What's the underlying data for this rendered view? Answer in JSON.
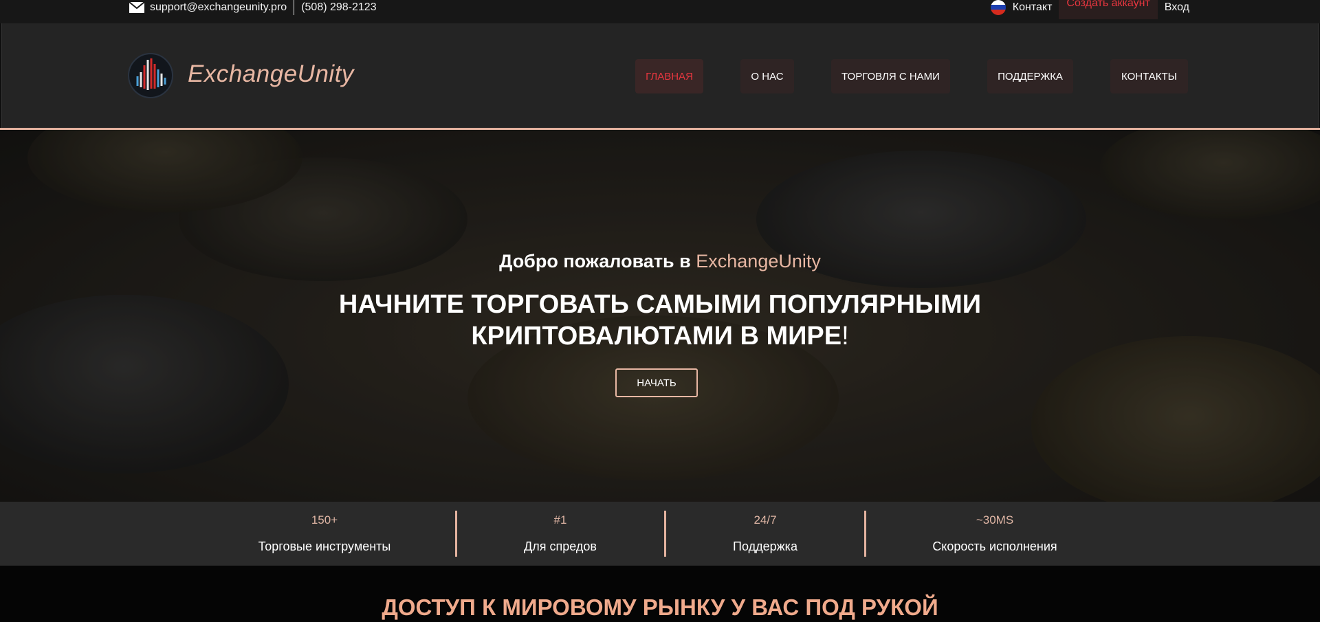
{
  "topbar": {
    "email": "support@exchangeunity.pro",
    "phone": "(508) 298-2123",
    "contact": "Контакт",
    "create_account": "Создать аккаунт",
    "login": "Вход",
    "icons": [
      "mail-icon",
      "russia-flag-icon"
    ]
  },
  "header": {
    "brand": "ExchangeUnity",
    "nav": [
      "ГЛАВНАЯ",
      "О НАС",
      "ТОРГОВЛЯ С НАМИ",
      "ПОДДЕРЖКА",
      "КОНТАКТЫ"
    ],
    "active_nav": "ГЛАВНАЯ"
  },
  "hero": {
    "welcome_prefix": "Добро пожаловать в",
    "welcome_brand": "ExchangeUnity",
    "headline_line1": "НАЧНИТЕ ТОРГОВАТЬ САМЫМИ ПОПУЛЯРНЫМИ",
    "headline_line2": "КРИПТОВАЛЮТАМИ В МИРЕ",
    "headline_excl": "!",
    "button": "НАЧАТЬ"
  },
  "stats": [
    {
      "value": "150+",
      "label": "Торговые инструменты"
    },
    {
      "value": "#1",
      "label": "Для спредов"
    },
    {
      "value": "24/7",
      "label": "Поддержка"
    },
    {
      "value": "~30MS",
      "label": "Скорость исполнения"
    }
  ],
  "section": {
    "title": "ДОСТУП К МИРОВОМУ РЫНКУ У ВАС ПОД РУКОЙ"
  },
  "colors": {
    "accent": "#e8b7a3",
    "active": "#e8363f",
    "title": "#f0aa8c"
  }
}
